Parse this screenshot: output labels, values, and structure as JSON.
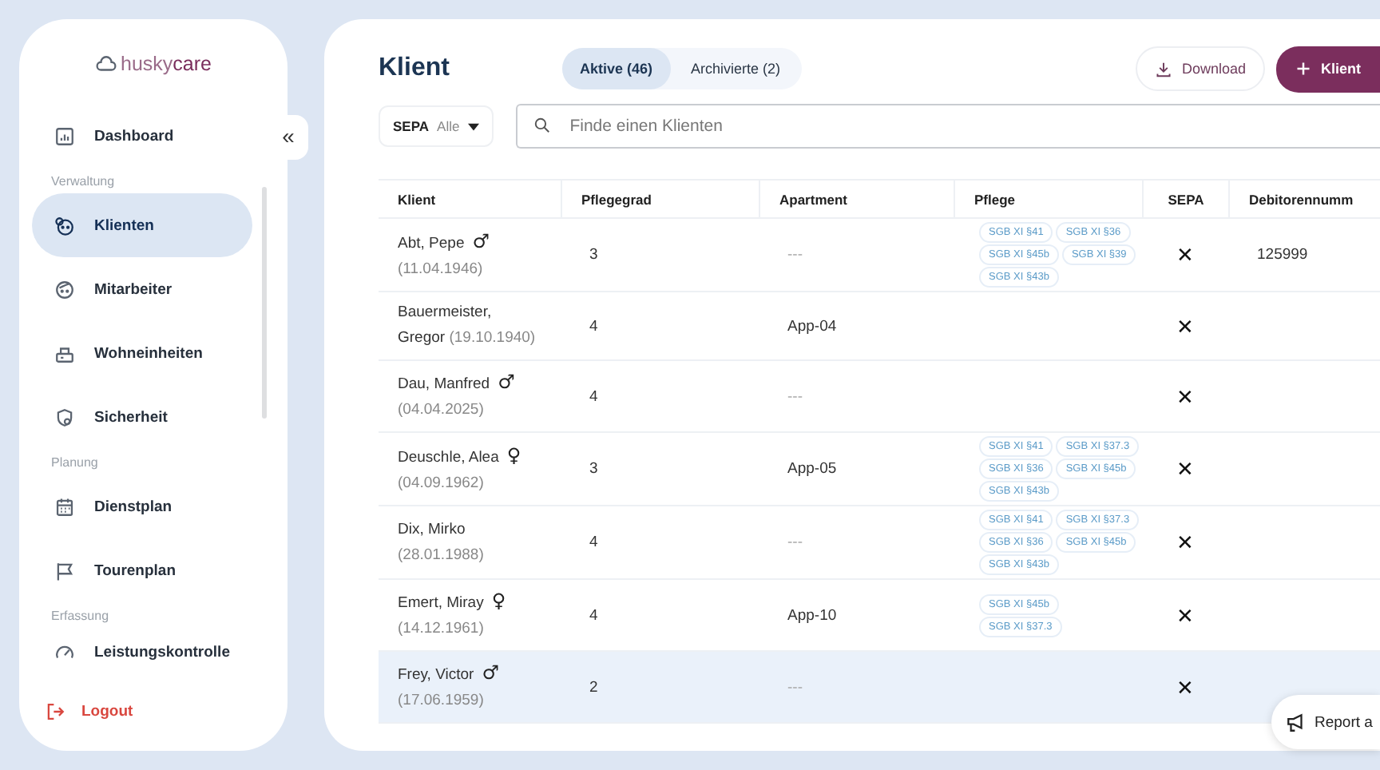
{
  "sidebar": {
    "logo_parts": [
      "husky",
      "care"
    ],
    "collapse_label": "«",
    "items": [
      {
        "kind": "item",
        "label": "Dashboard",
        "selected": false
      },
      {
        "kind": "section",
        "label": "Verwaltung"
      },
      {
        "kind": "item",
        "label": "Klienten",
        "selected": true
      },
      {
        "kind": "item",
        "label": "Mitarbeiter",
        "selected": false
      },
      {
        "kind": "item",
        "label": "Wohneinheiten",
        "selected": false
      },
      {
        "kind": "item",
        "label": "Sicherheit",
        "selected": false
      },
      {
        "kind": "section",
        "label": "Planung"
      },
      {
        "kind": "item",
        "label": "Dienstplan",
        "selected": false
      },
      {
        "kind": "item",
        "label": "Tourenplan",
        "selected": false
      },
      {
        "kind": "section",
        "label": "Erfassung"
      },
      {
        "kind": "item",
        "label": "Leistungskontrolle",
        "selected": false
      }
    ],
    "logout": "Logout"
  },
  "header": {
    "title": "Klient",
    "tabs": [
      {
        "label": "Aktive (46)",
        "selected": true
      },
      {
        "label": "Archivierte (2)",
        "selected": false
      }
    ],
    "download": "Download",
    "add": "Klient"
  },
  "filters": {
    "sepa_label": "SEPA",
    "sepa_value": "Alle",
    "search": {
      "placeholder": "Finde einen Klienten"
    }
  },
  "table": {
    "columns": [
      "Klient",
      "Pflegegrad",
      "Apartment",
      "Pflege",
      "SEPA",
      "Debitorennumm"
    ],
    "rows": [
      {
        "name": "Abt, Pepe",
        "gender": "♂",
        "birth": "(11.04.1946)",
        "pflegegrad": "3",
        "apartment": "---",
        "pflege": [
          "SGB XI §41",
          "SGB XI §36",
          "SGB XI §45b",
          "SGB XI §39",
          "SGB XI §43b"
        ],
        "sepa": "✕",
        "debitor": "125999",
        "selected": false
      },
      {
        "name": "Bauermeister, Gregor",
        "birth": "(19.10.1940)",
        "pflegegrad": "4",
        "apartment": "App-04",
        "sepa": "✕",
        "selected": false
      },
      {
        "name": "Dau, Manfred",
        "gender": "♂",
        "birth": "(04.04.2025)",
        "pflegegrad": "4",
        "apartment": "---",
        "sepa": "✕",
        "selected": false
      },
      {
        "name": "Deuschle, Alea",
        "gender": "♀",
        "birth": "(04.09.1962)",
        "pflegegrad": "3",
        "apartment": "App-05",
        "pflege": [
          "SGB XI §41",
          "SGB XI §37.3",
          "SGB XI §36",
          "SGB XI §45b",
          "SGB XI §43b"
        ],
        "sepa": "✕",
        "selected": false
      },
      {
        "name": "Dix, Mirko",
        "birth": "(28.01.1988)",
        "pflegegrad": "4",
        "apartment": "---",
        "pflege": [
          "SGB XI §41",
          "SGB XI §37.3",
          "SGB XI §36",
          "SGB XI §45b",
          "SGB XI §43b"
        ],
        "sepa": "✕",
        "selected": false
      },
      {
        "name": "Emert, Miray",
        "gender": "♀",
        "birth": "(14.12.1961)",
        "pflegegrad": "4",
        "apartment": "App-10",
        "pflege": [
          "SGB XI §45b",
          "SGB XI §37.3"
        ],
        "sepa": "✕",
        "selected": false
      },
      {
        "name": "Frey, Victor",
        "gender": "♂",
        "birth": "(17.06.1959)",
        "pflegegrad": "2",
        "apartment": "---",
        "sepa": "✕",
        "selected": true
      }
    ]
  },
  "report_button": "Report a"
}
